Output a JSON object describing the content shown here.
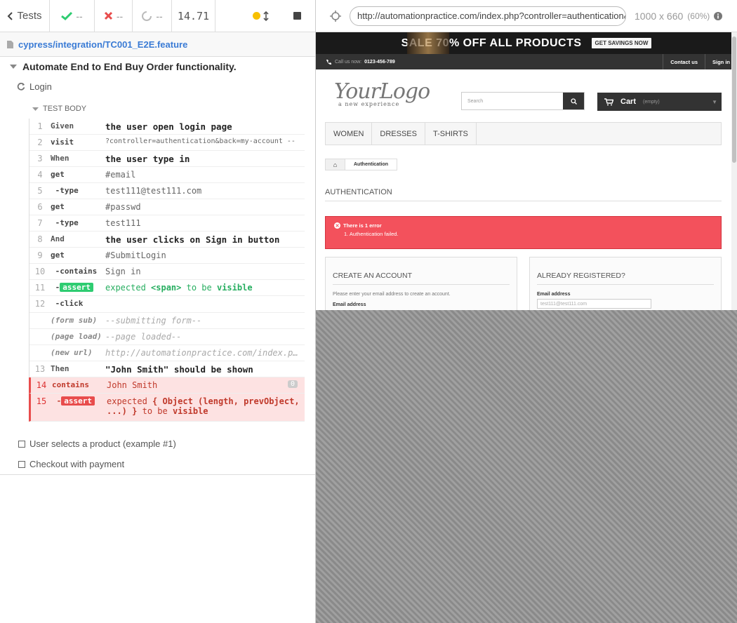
{
  "topbar": {
    "tests_label": "Tests",
    "passed": "--",
    "failed": "--",
    "pending": "--",
    "duration": "14.71"
  },
  "spec": {
    "path": "cypress/integration/TC001_E2E.feature"
  },
  "suite": {
    "title": "Automate End to End Buy Order functionality.",
    "test": "Login",
    "hook": "TEST BODY"
  },
  "commands": [
    {
      "num": "1",
      "name": "Given",
      "msg": "the user open login page"
    },
    {
      "num": "2",
      "name": "visit",
      "msg": "?controller=authentication&back=my-account --"
    },
    {
      "num": "3",
      "name": "When",
      "msg": "the user type in"
    },
    {
      "num": "4",
      "name": "get",
      "msg": "#email"
    },
    {
      "num": "5",
      "name": "type",
      "msg": "test111@test111.com"
    },
    {
      "num": "6",
      "name": "get",
      "msg": "#passwd"
    },
    {
      "num": "7",
      "name": "type",
      "msg": "test111"
    },
    {
      "num": "8",
      "name": "And",
      "msg": "the user clicks on Sign in button"
    },
    {
      "num": "9",
      "name": "get",
      "msg": "#SubmitLogin"
    },
    {
      "num": "10",
      "name": "contains",
      "msg": "Sign in"
    },
    {
      "num": "11",
      "name": "assert",
      "expected": "expected",
      "target": "<span>",
      "tobe": "to be",
      "state": "visible"
    },
    {
      "num": "12",
      "name": "click",
      "msg": ""
    },
    {
      "num": "",
      "name": "(form sub)",
      "msg": "--submitting form--"
    },
    {
      "num": "",
      "name": "(page load)",
      "msg": "--page loaded--"
    },
    {
      "num": "",
      "name": "(new url)",
      "msg": "http://automationpractice.com/index.php?controller=my-account"
    },
    {
      "num": "13",
      "name": "Then",
      "msg": "\"John Smith\" should be shown"
    },
    {
      "num": "14",
      "name": "contains",
      "msg": "John Smith",
      "count": "0"
    },
    {
      "num": "15",
      "name": "assert",
      "expected": "expected",
      "target": "{ Object (length, prevObject, ...) }",
      "tobe": "to be",
      "state": "visible"
    }
  ],
  "other_tests": [
    "User selects a product (example #1)",
    "Checkout with payment"
  ],
  "aut": {
    "url": "http://automationpractice.com/index.php?controller=authentication&back=my-account",
    "viewport": "1000 x 660",
    "scale": "(60%)"
  },
  "site": {
    "banner_text": "SALE 70% OFF ALL PRODUCTS",
    "banner_cta": "GET SAVINGS NOW",
    "call_label": "Call us now:",
    "phone": "0123-456-789",
    "contact": "Contact us",
    "signin": "Sign in",
    "logo": "YourLogo",
    "logo_tag": "a new experience",
    "search_placeholder": "Search",
    "cart": "Cart",
    "cart_state": "(empty)",
    "menu": [
      "WOMEN",
      "DRESSES",
      "T-SHIRTS"
    ],
    "crumb": "Authentication",
    "heading": "AUTHENTICATION",
    "alert_title": "There is 1 error",
    "alert_item": "1. Authentication failed.",
    "create_title": "CREATE AN ACCOUNT",
    "create_text": "Please enter your email address to create an account.",
    "create_email_label": "Email address",
    "login_title": "ALREADY REGISTERED?",
    "login_email_label": "Email address",
    "login_email_value": "test111@test111.com"
  },
  "colors": {
    "pass": "#2ecc71",
    "fail": "#e84c4c",
    "running": "#f7c000",
    "link": "#3a7bd5"
  }
}
